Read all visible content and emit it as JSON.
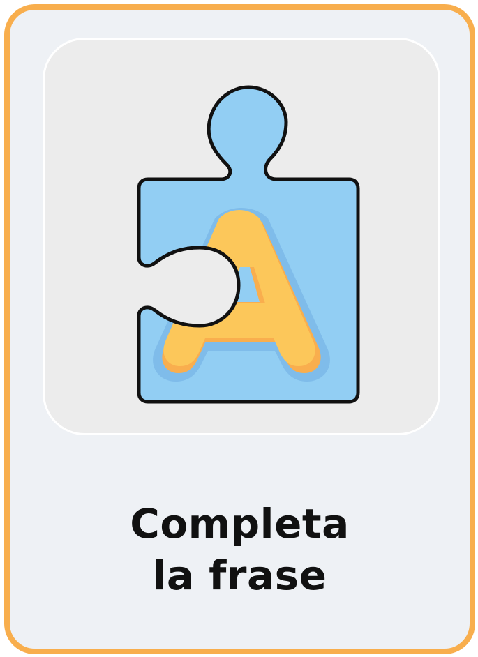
{
  "card": {
    "title_line1": "Completa",
    "title_line2": "la frase",
    "icon": "puzzle-piece-letter-a-icon",
    "icon_letter": "A"
  },
  "colors": {
    "border": "#F8AE4D",
    "background": "#EEF1F5",
    "tile": "#ECECEC",
    "puzzle_blue": "#92CEF3",
    "letter_yellow": "#FCC75A",
    "letter_shadow": "#F9AE4E",
    "letter_outline_blue": "#7FBCEA"
  }
}
